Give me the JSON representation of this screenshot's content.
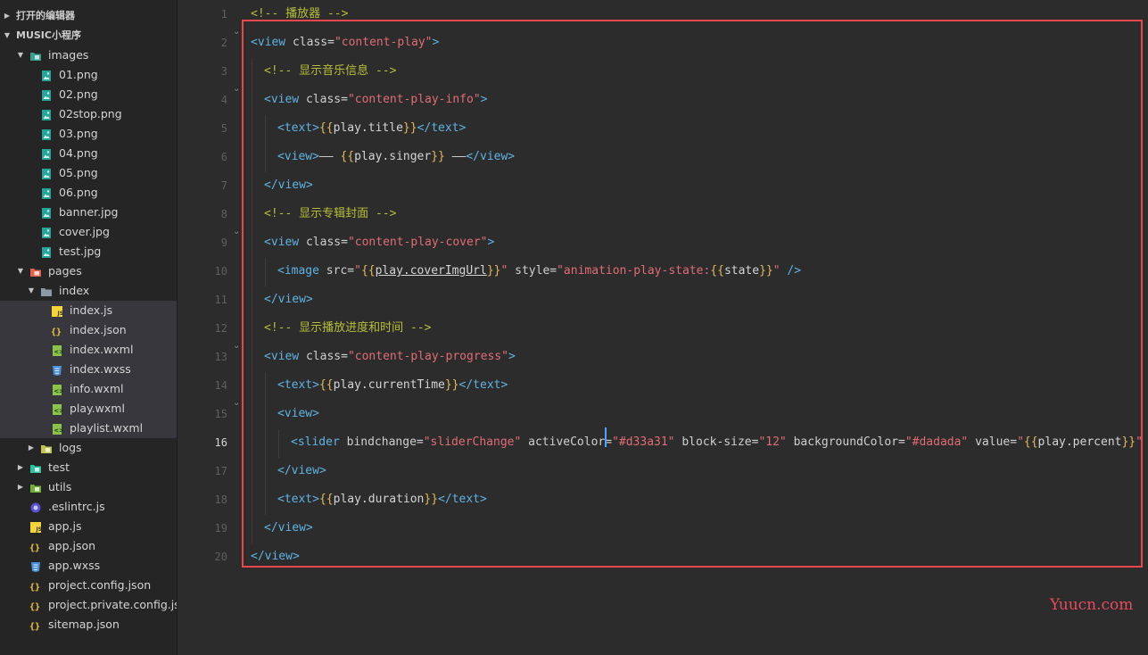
{
  "sidebar": {
    "sections": [
      {
        "label": "打开的编辑器",
        "expanded": false
      },
      {
        "label": "MUSIC小程序",
        "expanded": true
      }
    ],
    "tree": [
      {
        "label": "images",
        "kind": "folder",
        "icon": "images-folder-icon",
        "expanded": true
      },
      {
        "label": "01.png",
        "kind": "file",
        "icon": "image-file-icon"
      },
      {
        "label": "02.png",
        "kind": "file",
        "icon": "image-file-icon"
      },
      {
        "label": "02stop.png",
        "kind": "file",
        "icon": "image-file-icon"
      },
      {
        "label": "03.png",
        "kind": "file",
        "icon": "image-file-icon"
      },
      {
        "label": "04.png",
        "kind": "file",
        "icon": "image-file-icon"
      },
      {
        "label": "05.png",
        "kind": "file",
        "icon": "image-file-icon"
      },
      {
        "label": "06.png",
        "kind": "file",
        "icon": "image-file-icon"
      },
      {
        "label": "banner.jpg",
        "kind": "file",
        "icon": "image-file-icon"
      },
      {
        "label": "cover.jpg",
        "kind": "file",
        "icon": "image-file-icon"
      },
      {
        "label": "test.jpg",
        "kind": "file",
        "icon": "image-file-icon"
      },
      {
        "label": "pages",
        "kind": "folder",
        "icon": "pages-folder-icon",
        "expanded": true
      },
      {
        "label": "index",
        "kind": "folder",
        "icon": "folder-open-icon",
        "expanded": true
      },
      {
        "label": "index.js",
        "kind": "file",
        "icon": "js-file-icon",
        "selected": true
      },
      {
        "label": "index.json",
        "kind": "file",
        "icon": "json-file-icon",
        "selected": true
      },
      {
        "label": "index.wxml",
        "kind": "file",
        "icon": "wxml-file-icon",
        "selected": true
      },
      {
        "label": "index.wxss",
        "kind": "file",
        "icon": "css-file-icon",
        "selected": true
      },
      {
        "label": "info.wxml",
        "kind": "file",
        "icon": "wxml-file-icon",
        "selected": true
      },
      {
        "label": "play.wxml",
        "kind": "file",
        "icon": "wxml-file-icon",
        "selected": true
      },
      {
        "label": "playlist.wxml",
        "kind": "file",
        "icon": "wxml-file-icon",
        "selected": true
      },
      {
        "label": "logs",
        "kind": "folder",
        "icon": "logs-folder-icon",
        "expanded": false
      },
      {
        "label": "test",
        "kind": "folder",
        "icon": "test-folder-icon",
        "expanded": false
      },
      {
        "label": "utils",
        "kind": "folder",
        "icon": "utils-folder-icon",
        "expanded": false
      },
      {
        "label": ".eslintrc.js",
        "kind": "file",
        "icon": "eslint-file-icon"
      },
      {
        "label": "app.js",
        "kind": "file",
        "icon": "js-file-icon"
      },
      {
        "label": "app.json",
        "kind": "file",
        "icon": "json-file-icon"
      },
      {
        "label": "app.wxss",
        "kind": "file",
        "icon": "css-file-icon"
      },
      {
        "label": "project.config.json",
        "kind": "file",
        "icon": "json-file-icon"
      },
      {
        "label": "project.private.config.js...",
        "kind": "file",
        "icon": "json-file-icon"
      },
      {
        "label": "sitemap.json",
        "kind": "file",
        "icon": "json-file-icon"
      }
    ]
  },
  "editor": {
    "active_line": 16,
    "line_numbers": [
      "1",
      "2",
      "3",
      "4",
      "5",
      "6",
      "7",
      "8",
      "9",
      "10",
      "11",
      "12",
      "13",
      "14",
      "15",
      "16",
      "17",
      "18",
      "19",
      "20"
    ],
    "lines": [
      [
        [
          "comment",
          "<!-- 播放器 -->"
        ]
      ],
      [
        [
          "tag",
          "<view "
        ],
        [
          "attr",
          "class"
        ],
        [
          "punct",
          "="
        ],
        [
          "str",
          "\"content-play\""
        ],
        [
          "tag",
          ">"
        ]
      ],
      [
        [
          "comment",
          "<!-- 显示音乐信息 -->"
        ]
      ],
      [
        [
          "tag",
          "<view "
        ],
        [
          "attr",
          "class"
        ],
        [
          "punct",
          "="
        ],
        [
          "str",
          "\"content-play-info\""
        ],
        [
          "tag",
          ">"
        ]
      ],
      [
        [
          "tag",
          "<text>"
        ],
        [
          "brace",
          "{{"
        ],
        [
          "text",
          "play.title"
        ],
        [
          "brace",
          "}}"
        ],
        [
          "tag",
          "</text>"
        ]
      ],
      [
        [
          "tag",
          "<view>"
        ],
        [
          "text",
          "—— "
        ],
        [
          "brace",
          "{{"
        ],
        [
          "text",
          "play.singer"
        ],
        [
          "brace",
          "}}"
        ],
        [
          "text",
          " ——"
        ],
        [
          "tag",
          "</view>"
        ]
      ],
      [
        [
          "tag",
          "</view>"
        ]
      ],
      [
        [
          "comment",
          "<!-- 显示专辑封面 -->"
        ]
      ],
      [
        [
          "tag",
          "<view "
        ],
        [
          "attr",
          "class"
        ],
        [
          "punct",
          "="
        ],
        [
          "str",
          "\"content-play-cover\""
        ],
        [
          "tag",
          ">"
        ]
      ],
      [
        [
          "tag",
          "<image "
        ],
        [
          "attr",
          "src"
        ],
        [
          "punct",
          "="
        ],
        [
          "str",
          "\""
        ],
        [
          "brace",
          "{{"
        ],
        [
          "ul",
          "play.coverImgUrl"
        ],
        [
          "brace",
          "}}"
        ],
        [
          "str",
          "\""
        ],
        [
          "attr",
          " style"
        ],
        [
          "punct",
          "="
        ],
        [
          "str",
          "\"animation-play-state:"
        ],
        [
          "brace",
          "{{"
        ],
        [
          "text",
          "state"
        ],
        [
          "brace",
          "}}"
        ],
        [
          "str",
          "\""
        ],
        [
          "tag",
          " />"
        ]
      ],
      [
        [
          "tag",
          "</view>"
        ]
      ],
      [
        [
          "comment",
          "<!-- 显示播放进度和时间 -->"
        ]
      ],
      [
        [
          "tag",
          "<view "
        ],
        [
          "attr",
          "class"
        ],
        [
          "punct",
          "="
        ],
        [
          "str",
          "\"content-play-progress\""
        ],
        [
          "tag",
          ">"
        ]
      ],
      [
        [
          "tag",
          "<text>"
        ],
        [
          "brace",
          "{{"
        ],
        [
          "text",
          "play.currentTime"
        ],
        [
          "brace",
          "}}"
        ],
        [
          "tag",
          "</text>"
        ]
      ],
      [
        [
          "tag",
          "<view>"
        ]
      ],
      [
        [
          "tag",
          "<slider "
        ],
        [
          "attr",
          "bindchange"
        ],
        [
          "punct",
          "="
        ],
        [
          "str",
          "\"sliderChange\""
        ],
        [
          "attr",
          " activeColor"
        ],
        [
          "punct",
          "="
        ],
        [
          "str",
          "\"#d33a31\""
        ],
        [
          "attr",
          " block-size"
        ],
        [
          "punct",
          "="
        ],
        [
          "str",
          "\"12\""
        ],
        [
          "attr",
          " backgroundColor"
        ],
        [
          "punct",
          "="
        ],
        [
          "str",
          "\"#dadada\""
        ],
        [
          "attr",
          " value"
        ],
        [
          "punct",
          "="
        ],
        [
          "str",
          "\""
        ],
        [
          "brace",
          "{{"
        ],
        [
          "text",
          "play.percent"
        ],
        [
          "brace",
          "}}"
        ],
        [
          "str",
          "\""
        ],
        [
          "tag",
          " /"
        ]
      ],
      [
        [
          "tag",
          "</view>"
        ]
      ],
      [
        [
          "tag",
          "<text>"
        ],
        [
          "brace",
          "{{"
        ],
        [
          "text",
          "play.duration"
        ],
        [
          "brace",
          "}}"
        ],
        [
          "tag",
          "</text>"
        ]
      ],
      [
        [
          "tag",
          "</view>"
        ]
      ],
      [
        [
          "tag",
          "</view>"
        ]
      ]
    ]
  },
  "watermark": "Yuucn.com",
  "colors": {
    "highlight_box": "#e8474e",
    "comment": "#b6bf3a",
    "tag": "#5fb3e3",
    "string": "#e06c75",
    "brace": "#e5b85c"
  }
}
